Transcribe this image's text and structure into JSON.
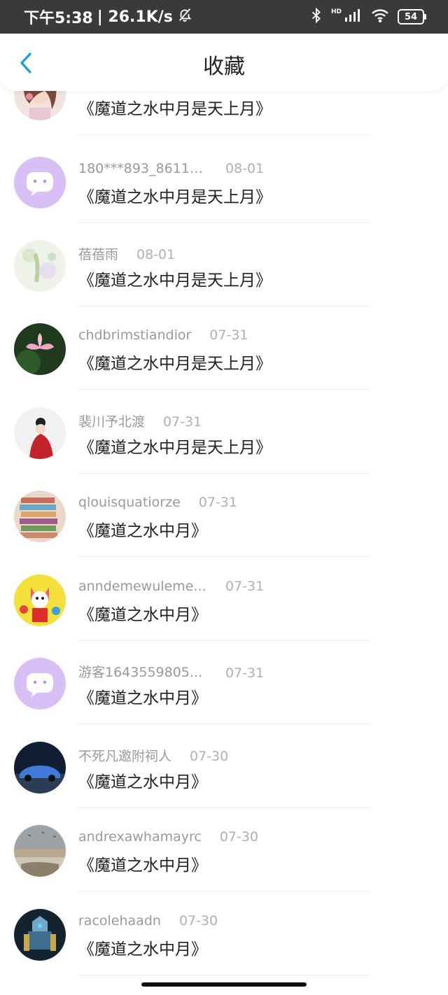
{
  "status_bar": {
    "time": "下午5:38",
    "speed": "| 26.1K/s",
    "battery": "54",
    "hd": "HD"
  },
  "header": {
    "title": "收藏"
  },
  "items": [
    {
      "user": "",
      "date": "",
      "title": "《魔道之水中月是天上月》",
      "avatar": "girl-illustration"
    },
    {
      "user": "180***893_86111...",
      "date": "08-01",
      "title": "《魔道之水中月是天上月》",
      "avatar": "chat-bubble"
    },
    {
      "user": "蓓蓓雨",
      "date": "08-01",
      "title": "《魔道之水中月是天上月》",
      "avatar": "watercolor"
    },
    {
      "user": "chdbrimstiandior",
      "date": "07-31",
      "title": "《魔道之水中月是天上月》",
      "avatar": "lotus"
    },
    {
      "user": "裴川予北渡",
      "date": "07-31",
      "title": "《魔道之水中月是天上月》",
      "avatar": "red-dress"
    },
    {
      "user": "qlouisquatiorze",
      "date": "07-31",
      "title": "《魔道之水中月》",
      "avatar": "books"
    },
    {
      "user": "anndemewuleme...",
      "date": "07-31",
      "title": "《魔道之水中月》",
      "avatar": "cartoon-cat"
    },
    {
      "user": "游客1643559805...",
      "date": "07-31",
      "title": "《魔道之水中月》",
      "avatar": "chat-bubble"
    },
    {
      "user": "不死凡邀附祠人",
      "date": "07-30",
      "title": "《魔道之水中月》",
      "avatar": "car"
    },
    {
      "user": "andrexawhamayrc",
      "date": "07-30",
      "title": "《魔道之水中月》",
      "avatar": "beach"
    },
    {
      "user": "racolehaadn",
      "date": "07-30",
      "title": "《魔道之水中月》",
      "avatar": "mecha"
    }
  ],
  "colors": {
    "accent": "#1a9be8",
    "chat_avatar": "#d8bff5",
    "status_bar": "#3a3a3a"
  }
}
